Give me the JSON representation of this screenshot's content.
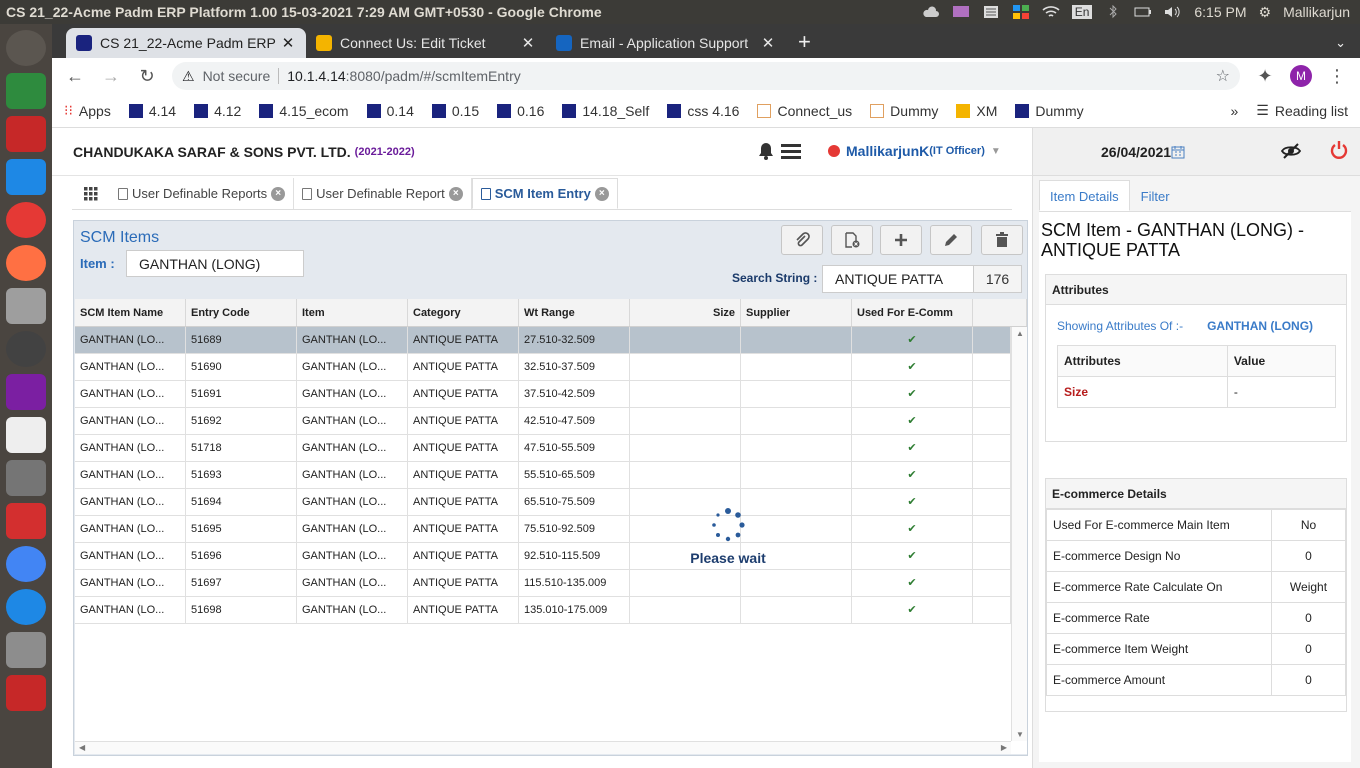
{
  "os": {
    "window_title": "CS 21_22-Acme Padm ERP Platform 1.00 15-03-2021 7:29 AM GMT+0530 - Google Chrome",
    "lang": "En",
    "time": "6:15 PM",
    "user": "Mallikarjun"
  },
  "browser": {
    "tabs": [
      {
        "label": "CS 21_22-Acme Padm ERP Platform 1.00",
        "active": true
      },
      {
        "label": "Connect Us: Edit Ticket",
        "active": false
      },
      {
        "label": "Email - Application Support",
        "active": false
      }
    ],
    "not_secure": "Not secure",
    "url_host": "10.1.4.14",
    "url_path": ":8080/padm/#/scmItemEntry",
    "avatar_letter": "M",
    "bookmarks": [
      "Apps",
      "4.14",
      "4.12",
      "4.15_ecom",
      "0.14",
      "0.15",
      "0.16",
      "14.18_Self",
      "css 4.16",
      "Connect_us",
      "Dummy",
      "XM",
      "Dummy"
    ],
    "reading_list": "Reading list"
  },
  "header": {
    "company": "CHANDUKAKA SARAF & SONS PVT. LTD.",
    "fiscal_year": "(2021-2022)",
    "user_name": "MallikarjunK",
    "user_role": "(IT Officer)",
    "date": "26/04/2021"
  },
  "page_tabs": [
    {
      "label": "User Definable Reports",
      "active": false
    },
    {
      "label": "User Definable Report",
      "active": false
    },
    {
      "label": "SCM Item Entry",
      "active": true
    }
  ],
  "panel": {
    "title": "SCM Items",
    "item_label": "Item :",
    "item_value": "GANTHAN (LONG)",
    "search_label": "Search String :",
    "search_value": "ANTIQUE PATTA",
    "count": "176"
  },
  "grid": {
    "columns": [
      "SCM Item Name",
      "Entry Code",
      "Item",
      "Category",
      "Wt Range",
      "Size",
      "Supplier",
      "Used For E-Comm"
    ],
    "rows": [
      {
        "name": "GANTHAN (LO...",
        "code": "51689",
        "item": "GANTHAN (LO...",
        "category": "ANTIQUE PATTA",
        "wt": "27.510-32.509",
        "size": "",
        "supplier": "",
        "ecomm": "✔"
      },
      {
        "name": "GANTHAN (LO...",
        "code": "51690",
        "item": "GANTHAN (LO...",
        "category": "ANTIQUE PATTA",
        "wt": "32.510-37.509",
        "size": "",
        "supplier": "",
        "ecomm": "✔"
      },
      {
        "name": "GANTHAN (LO...",
        "code": "51691",
        "item": "GANTHAN (LO...",
        "category": "ANTIQUE PATTA",
        "wt": "37.510-42.509",
        "size": "",
        "supplier": "",
        "ecomm": "✔"
      },
      {
        "name": "GANTHAN (LO...",
        "code": "51692",
        "item": "GANTHAN (LO...",
        "category": "ANTIQUE PATTA",
        "wt": "42.510-47.509",
        "size": "",
        "supplier": "",
        "ecomm": "✔"
      },
      {
        "name": "GANTHAN (LO...",
        "code": "51718",
        "item": "GANTHAN (LO...",
        "category": "ANTIQUE PATTA",
        "wt": "47.510-55.509",
        "size": "",
        "supplier": "",
        "ecomm": "✔"
      },
      {
        "name": "GANTHAN (LO...",
        "code": "51693",
        "item": "GANTHAN (LO...",
        "category": "ANTIQUE PATTA",
        "wt": "55.510-65.509",
        "size": "",
        "supplier": "",
        "ecomm": "✔"
      },
      {
        "name": "GANTHAN (LO...",
        "code": "51694",
        "item": "GANTHAN (LO...",
        "category": "ANTIQUE PATTA",
        "wt": "65.510-75.509",
        "size": "",
        "supplier": "",
        "ecomm": "✔"
      },
      {
        "name": "GANTHAN (LO...",
        "code": "51695",
        "item": "GANTHAN (LO...",
        "category": "ANTIQUE PATTA",
        "wt": "75.510-92.509",
        "size": "",
        "supplier": "",
        "ecomm": "✔"
      },
      {
        "name": "GANTHAN (LO...",
        "code": "51696",
        "item": "GANTHAN (LO...",
        "category": "ANTIQUE PATTA",
        "wt": "92.510-115.509",
        "size": "",
        "supplier": "",
        "ecomm": "✔"
      },
      {
        "name": "GANTHAN (LO...",
        "code": "51697",
        "item": "GANTHAN (LO...",
        "category": "ANTIQUE PATTA",
        "wt": "115.510-135.009",
        "size": "",
        "supplier": "",
        "ecomm": "✔"
      },
      {
        "name": "GANTHAN (LO...",
        "code": "51698",
        "item": "GANTHAN (LO...",
        "category": "ANTIQUE PATTA",
        "wt": "135.010-175.009",
        "size": "",
        "supplier": "",
        "ecomm": "✔"
      }
    ],
    "loading_text": "Please wait"
  },
  "right": {
    "tabs": [
      "Item Details",
      "Filter"
    ],
    "scm_title": "SCM Item - GANTHAN (LONG) - ANTIQUE PATTA",
    "attributes_header": "Attributes",
    "showing_label": "Showing Attributes Of :-",
    "showing_value": "GANTHAN (LONG)",
    "attr_cols": [
      "Attributes",
      "Value"
    ],
    "attr_rows": [
      {
        "name": "Size",
        "value": "-"
      }
    ],
    "ecom_header": "E-commerce Details",
    "ecom_rows": [
      {
        "label": "Used For E-commerce Main Item",
        "value": "No"
      },
      {
        "label": "E-commerce Design No",
        "value": "0"
      },
      {
        "label": "E-commerce Rate Calculate On",
        "value": "Weight"
      },
      {
        "label": "E-commerce Rate",
        "value": "0"
      },
      {
        "label": "E-commerce Item Weight",
        "value": "0"
      },
      {
        "label": "E-commerce Amount",
        "value": "0"
      }
    ]
  }
}
